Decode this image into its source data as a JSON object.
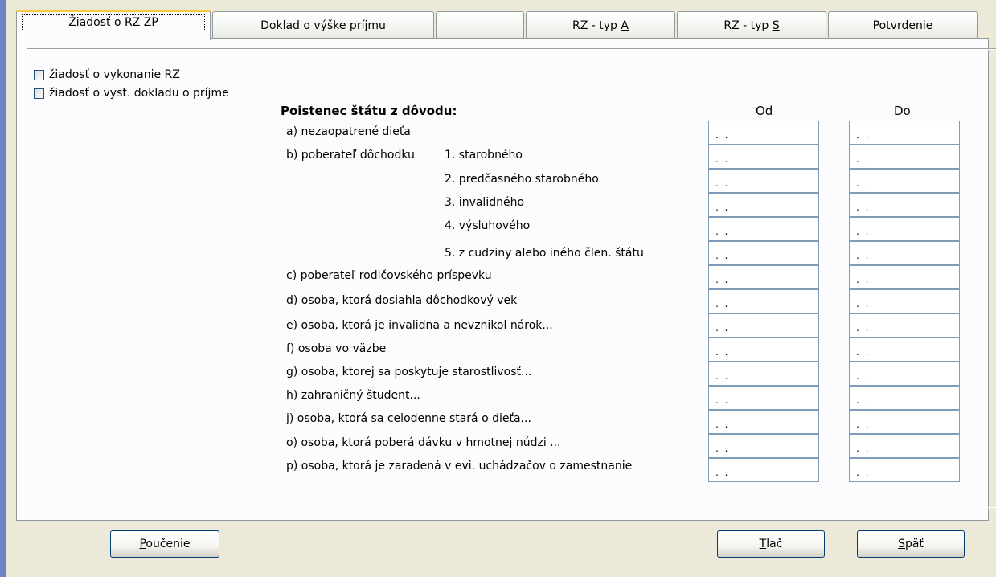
{
  "tabs": [
    {
      "label": "Žiadosť o RZ ZP",
      "active": true
    },
    {
      "label": "Doklad o výške príjmu"
    },
    {
      "label": ""
    },
    {
      "label": "RZ - typ A",
      "underline": "A"
    },
    {
      "label": "RZ - typ S",
      "underline": "S"
    },
    {
      "label": "Potvrdenie"
    }
  ],
  "checkboxes": [
    {
      "label": "žiadosť o vykonanie RZ",
      "checked": false
    },
    {
      "label": "žiadosť o vyst. dokladu o príjme",
      "checked": false
    }
  ],
  "form": {
    "title": "Poistenec štátu z dôvodu:",
    "col_from": "Od",
    "col_to": "Do",
    "b_prefix": "b) poberateľ dôchodku",
    "rows": [
      "a) nezaopatrené dieťa",
      "1. starobného",
      "2. predčasného starobného",
      "3. invalidného",
      "4. výsluhového",
      "5. z cudziny alebo iného člen. štátu",
      "c) poberateľ rodičovského príspevku",
      "d) osoba, ktorá dosiahla dôchodkový vek",
      "e) osoba, ktorá je invalidna a nevznikol nárok...",
      "f) osoba vo väzbe",
      "g) osoba, ktorej sa poskytuje starostlivosť...",
      "h) zahraničný študent...",
      "j) osoba, ktorá sa celodenne stará o dieťa...",
      "o) osoba, ktorá poberá dávku v hmotnej núdzi ...",
      "p) osoba, ktorá je zaradená v evi. uchádzačov o zamestnanie"
    ],
    "date_placeholder": ". ."
  },
  "buttons": {
    "poucenie": {
      "first": "P",
      "rest": "oučenie"
    },
    "tlac": {
      "first": "T",
      "rest": "lač"
    },
    "spat": {
      "first": "S",
      "rest": "päť"
    }
  }
}
